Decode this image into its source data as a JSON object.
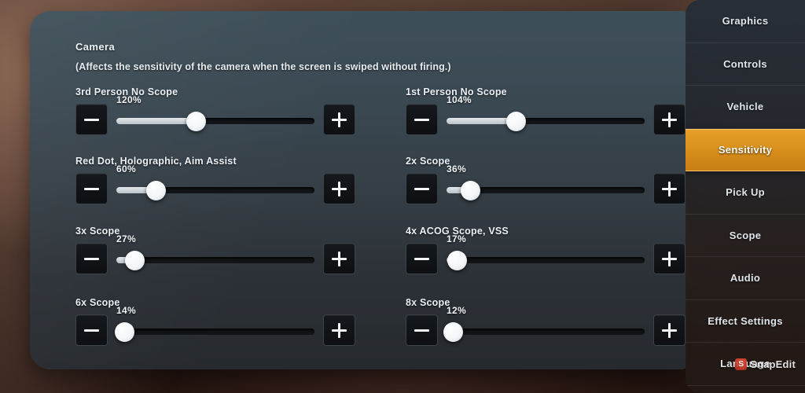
{
  "panel": {
    "section_title": "Camera",
    "section_subtitle": "(Affects the sensitivity of the camera when the screen is swiped without firing.)",
    "accent_color": "#d98f1c",
    "panel_color": "#3a4852"
  },
  "controls": {
    "decrease_label": "−",
    "increase_label": "+"
  },
  "settings": [
    {
      "label": "3rd Person No Scope",
      "value": "120%",
      "knob_pct": 40,
      "column": "left",
      "row": 0
    },
    {
      "label": "Red Dot, Holographic, Aim Assist",
      "value": "60%",
      "knob_pct": 20,
      "column": "left",
      "row": 1
    },
    {
      "label": "3x Scope",
      "value": "27%",
      "knob_pct": 9,
      "column": "left",
      "row": 2
    },
    {
      "label": "6x Scope",
      "value": "14%",
      "knob_pct": 4,
      "column": "left",
      "row": 3
    },
    {
      "label": "1st Person No Scope",
      "value": "104%",
      "knob_pct": 35,
      "column": "right",
      "row": 0
    },
    {
      "label": "2x Scope",
      "value": "36%",
      "knob_pct": 12,
      "column": "right",
      "row": 1
    },
    {
      "label": "4x ACOG Scope, VSS",
      "value": "17%",
      "knob_pct": 5,
      "column": "right",
      "row": 2
    },
    {
      "label": "8x Scope",
      "value": "12%",
      "knob_pct": 3,
      "column": "right",
      "row": 3
    }
  ],
  "rail": {
    "tabs": [
      {
        "label": "Graphics",
        "active": false
      },
      {
        "label": "Controls",
        "active": false
      },
      {
        "label": "Vehicle",
        "active": false
      },
      {
        "label": "Sensitivity",
        "active": true
      },
      {
        "label": "Pick Up",
        "active": false
      },
      {
        "label": "Scope",
        "active": false
      },
      {
        "label": "Audio",
        "active": false
      },
      {
        "label": "Effect Settings",
        "active": false
      },
      {
        "label": "Language",
        "active": false
      }
    ]
  },
  "watermark": {
    "badge": "S",
    "text": "SnapEdit"
  }
}
